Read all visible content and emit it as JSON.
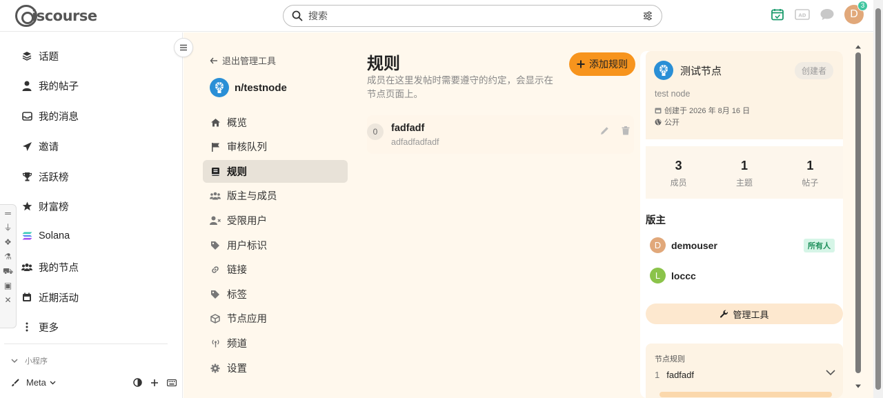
{
  "header": {
    "logo_text": "iscourse",
    "search_placeholder": "搜索",
    "avatar_letter": "D",
    "notification_count": "3"
  },
  "sidebar": {
    "items": [
      {
        "label": "话题",
        "icon": "layers-icon"
      },
      {
        "label": "我的帖子",
        "icon": "user-icon"
      },
      {
        "label": "我的消息",
        "icon": "inbox-icon"
      },
      {
        "label": "邀请",
        "icon": "paper-plane-icon"
      },
      {
        "label": "活跃榜",
        "icon": "trophy-icon"
      },
      {
        "label": "财富榜",
        "icon": "star-icon"
      },
      {
        "label": "Solana",
        "icon": "solana-icon"
      },
      {
        "label": "我的节点",
        "icon": "users-icon"
      },
      {
        "label": "近期活动",
        "icon": "calendar-icon"
      },
      {
        "label": "更多",
        "icon": "more-vertical-icon"
      }
    ],
    "section_label": "小程序",
    "bottom_label": "Meta"
  },
  "admin": {
    "exit_label": "退出管理工具",
    "node_name": "n/testnode",
    "nav": [
      {
        "label": "概览",
        "icon": "home-icon",
        "active": false
      },
      {
        "label": "审核队列",
        "icon": "flag-icon",
        "active": false
      },
      {
        "label": "规则",
        "icon": "book-icon",
        "active": true
      },
      {
        "label": "版主与成员",
        "icon": "users-icon",
        "active": false
      },
      {
        "label": "受限用户",
        "icon": "user-x-icon",
        "active": false
      },
      {
        "label": "用户标识",
        "icon": "tag-icon",
        "active": false
      },
      {
        "label": "链接",
        "icon": "link-icon",
        "active": false
      },
      {
        "label": "标签",
        "icon": "tag-icon",
        "active": false
      },
      {
        "label": "节点应用",
        "icon": "cube-icon",
        "active": false
      },
      {
        "label": "频道",
        "icon": "broadcast-icon",
        "active": false
      },
      {
        "label": "设置",
        "icon": "gear-icon",
        "active": false
      }
    ]
  },
  "content": {
    "title": "规则",
    "description": "成员在这里发帖时需要遵守的约定，会显示在节点页面上。",
    "add_button": "添加规则",
    "rules": [
      {
        "index": "0",
        "title": "fadfadf",
        "detail": "adfadfadfadf"
      }
    ]
  },
  "panel": {
    "node_title": "测试节点",
    "creator_label": "创建者",
    "english_name": "test node",
    "created": "创建于 2026 年 8月 16 日",
    "visibility": "公开",
    "stats": [
      {
        "value": "3",
        "label": "成员"
      },
      {
        "value": "1",
        "label": "主题"
      },
      {
        "value": "1",
        "label": "帖子"
      }
    ],
    "mods_title": "版主",
    "mods": [
      {
        "initial": "D",
        "name": "demouser",
        "tag": "所有人",
        "color": "#e1a87a"
      },
      {
        "initial": "L",
        "name": "loccc",
        "tag": "",
        "color": "#8bc34a"
      }
    ],
    "tools_button": "管理工具",
    "rules_title": "节点规则",
    "rules": [
      {
        "index": "1",
        "title": "fadfadf"
      }
    ]
  },
  "colors": {
    "accent": "#f7941d",
    "main_bg": "#fff8ed",
    "owner_tag_bg": "#d6f5e7",
    "owner_tag_text": "#1d8f5a"
  }
}
